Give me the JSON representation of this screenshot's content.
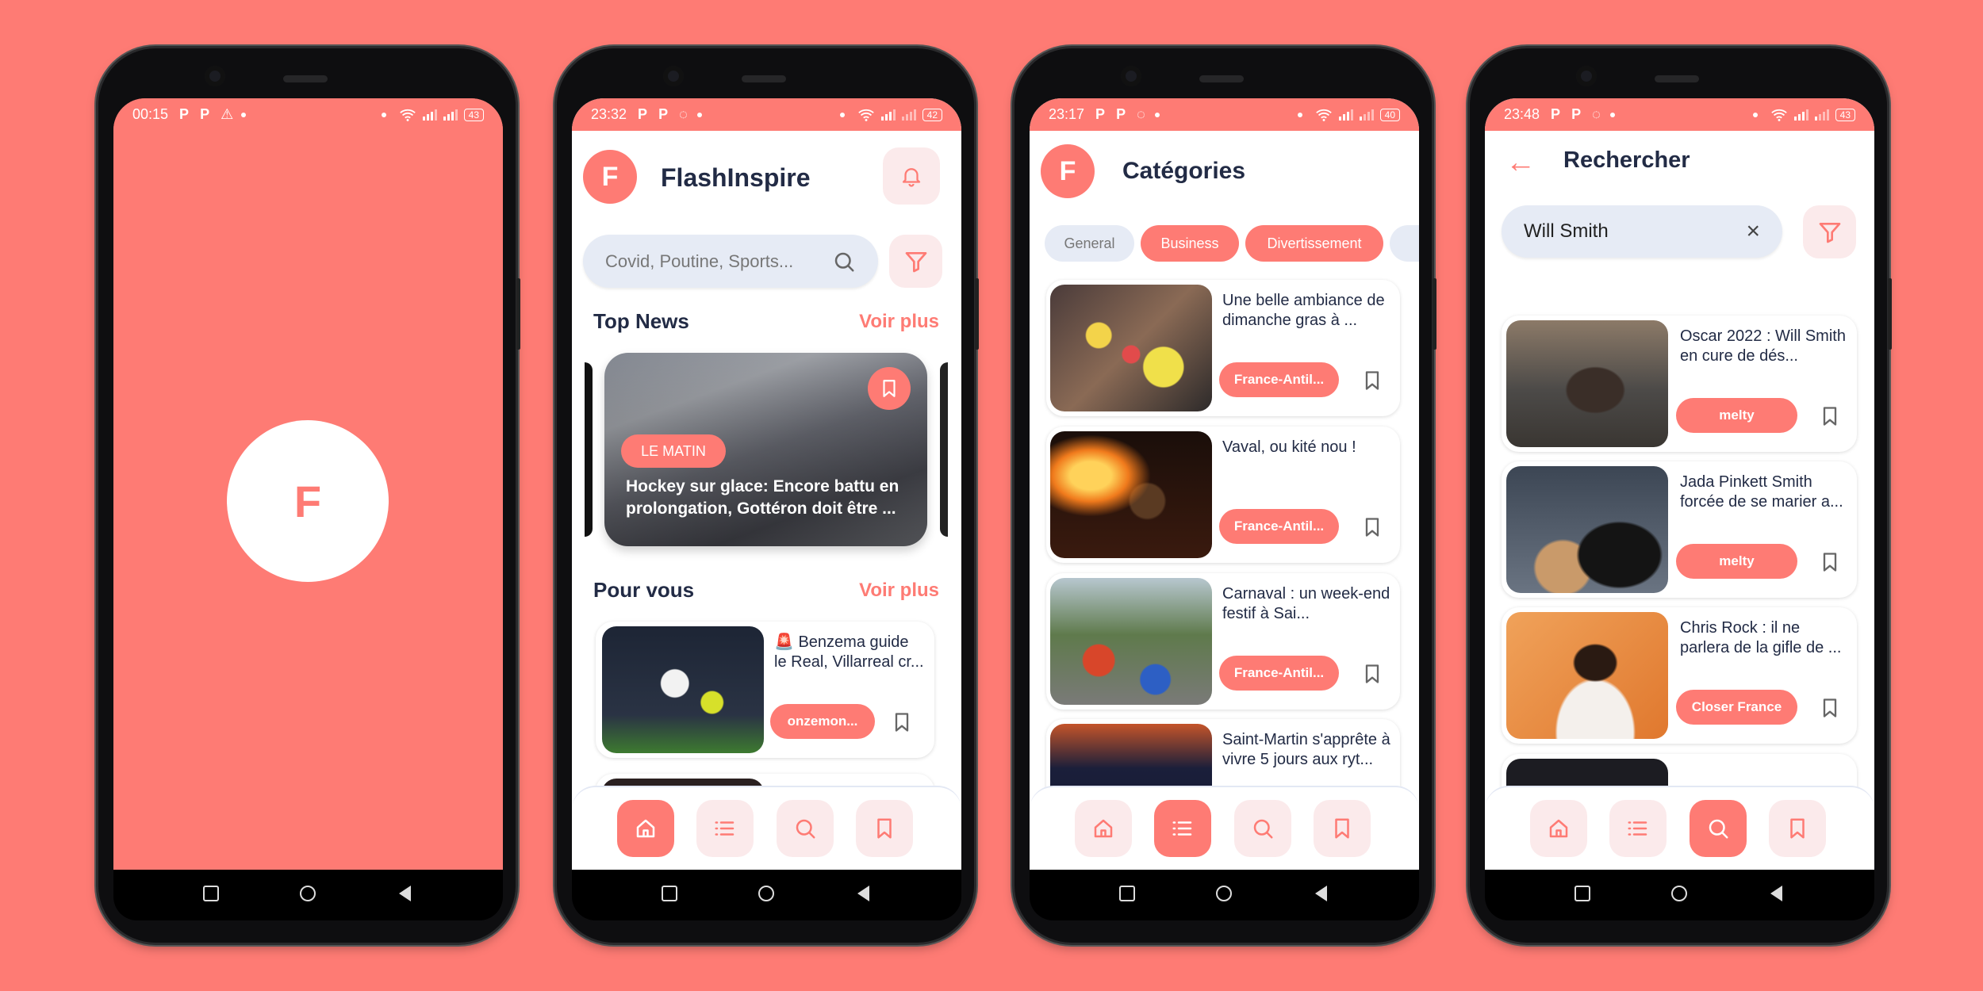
{
  "colors": {
    "brand": "#FE7B74",
    "soft": "#FBEAEB",
    "input": "#E6EBF5",
    "text": "#222B45"
  },
  "logo_letter": "F",
  "splash": {
    "status": {
      "time": "00:15",
      "battery": "43"
    }
  },
  "home": {
    "status": {
      "time": "23:32",
      "battery": "42"
    },
    "app_title": "FlashInspire",
    "search_placeholder": "Covid, Poutine, Sports...",
    "top_news": {
      "heading": "Top News",
      "more": "Voir plus",
      "featured": {
        "source": "LE MATIN",
        "title": "Hockey sur glace: Encore battu en prolongation, Gottéron doit être ..."
      }
    },
    "for_you": {
      "heading": "Pour vous",
      "more": "Voir plus",
      "items": [
        {
          "title": "🚨 Benzema guide le Real, Villarreal cr...",
          "source": "onzemon..."
        }
      ]
    }
  },
  "categories": {
    "status": {
      "time": "23:17",
      "battery": "40"
    },
    "title": "Catégories",
    "chips": [
      "General",
      "Business",
      "Divertissement"
    ],
    "items": [
      {
        "title": "Une belle ambiance de dimanche gras à ...",
        "source": "France-Antil..."
      },
      {
        "title": "Vaval, ou kité nou !",
        "source": "France-Antil..."
      },
      {
        "title": "Carnaval : un week-end festif à Sai...",
        "source": "France-Antil..."
      },
      {
        "title": "Saint-Martin s'apprête à vivre 5 jours aux ryt..."
      }
    ]
  },
  "search": {
    "status": {
      "time": "23:48",
      "battery": "43"
    },
    "title": "Rechercher",
    "query": "Will Smith",
    "results": [
      {
        "title": "Oscar 2022 : Will Smith en cure de dés...",
        "source": "melty"
      },
      {
        "title": "Jada Pinkett Smith forcée de se marier a...",
        "source": "melty"
      },
      {
        "title": "Chris Rock : il ne parlera de la gifle de ...",
        "source": "Closer France"
      }
    ]
  },
  "status_icons": {
    "p1": "P",
    "p2": "P"
  }
}
